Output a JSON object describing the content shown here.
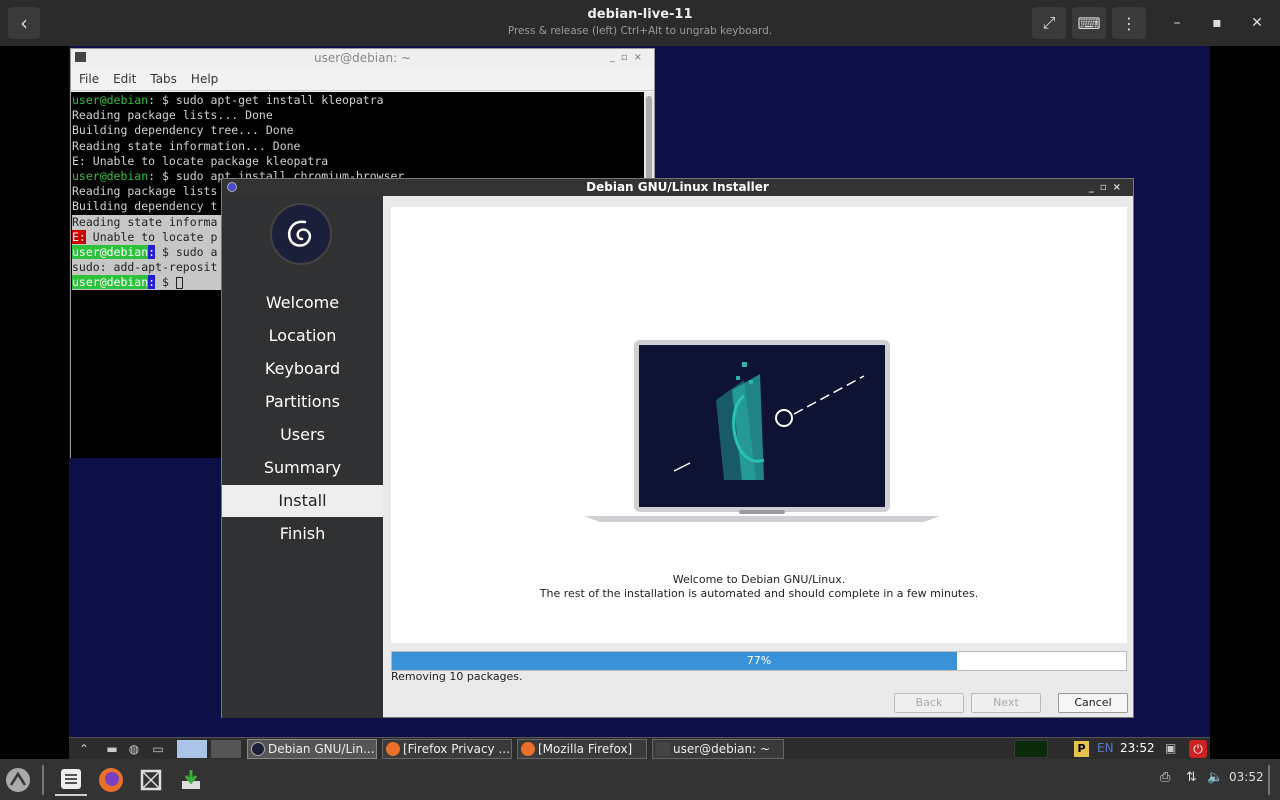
{
  "viewer": {
    "title": "debian-live-11",
    "subtitle": "Press & release (left) Ctrl+Alt to ungrab keyboard."
  },
  "terminal": {
    "title": "user@debian: ~",
    "menu": [
      "File",
      "Edit",
      "Tabs",
      "Help"
    ],
    "prompt": "user@debian",
    "lines": [
      {
        "prompt": "user@debian",
        "rest": ": $ sudo apt-get install kleopatra"
      },
      {
        "text": "Reading package lists... Done"
      },
      {
        "text": "Building dependency tree... Done"
      },
      {
        "text": "Reading state information... Done"
      },
      {
        "text": "E: Unable to locate package kleopatra"
      },
      {
        "prompt": "user@debian",
        "rest": ": $ sudo apt install chromium-browser"
      },
      {
        "text": "Reading package lists"
      },
      {
        "text": "Building dependency t"
      },
      {
        "text": "Reading state informa"
      },
      {
        "err": "E:",
        "text": " Unable to locate p"
      },
      {
        "prompt": "user@debian",
        "rest": " $ sudo a"
      },
      {
        "text": "sudo: add-apt-reposit"
      },
      {
        "prompt": "user@debian",
        "rest": " $ "
      }
    ]
  },
  "installer": {
    "title": "Debian GNU/Linux Installer",
    "steps": [
      "Welcome",
      "Location",
      "Keyboard",
      "Partitions",
      "Users",
      "Summary",
      "Install",
      "Finish"
    ],
    "active_step": "Install",
    "welcome_line1": "Welcome to Debian GNU/Linux.",
    "welcome_line2": "The rest of the installation is automated and should complete in a few minutes.",
    "progress": 0.77,
    "progress_label": "77%",
    "status": "Removing 10 packages.",
    "back_label": "Back",
    "next_label": "Next",
    "cancel_label": "Cancel"
  },
  "vm_taskbar": {
    "tasks": [
      {
        "label": "Debian GNU/Lin...",
        "icon": "debian-icon"
      },
      {
        "label": "[Firefox Privacy ...",
        "icon": "firefox-icon"
      },
      {
        "label": "[Mozilla Firefox]",
        "icon": "firefox-icon"
      },
      {
        "label": "user@debian: ~",
        "icon": "terminal-icon"
      }
    ],
    "keyboard_layout": "EN",
    "clock": "23:52",
    "indicator": "P"
  },
  "host_bar": {
    "clock": "03:52"
  },
  "colors": {
    "installer_sidebar": "#2f3132",
    "progress_fill": "#3a93d8",
    "terminal_prompt": "#2ec13c",
    "vm_background": "#0c1046"
  }
}
